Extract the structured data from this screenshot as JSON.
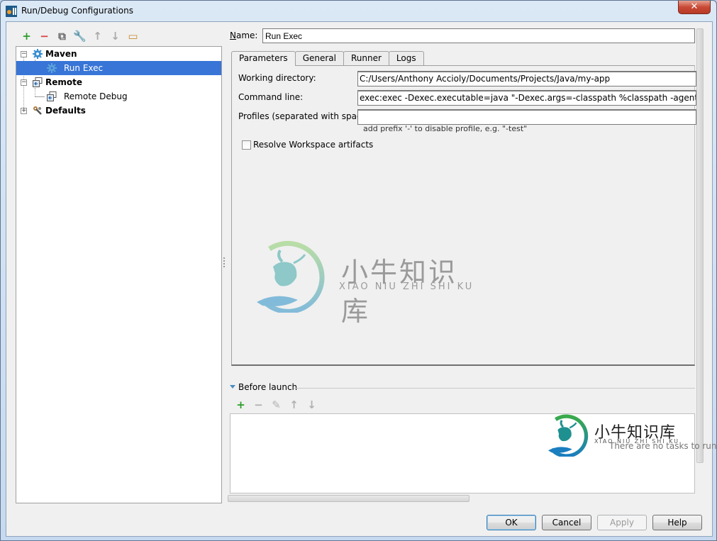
{
  "window": {
    "title": "Run/Debug Configurations",
    "close_glyph": "✕"
  },
  "toolbar": {
    "items": [
      {
        "name": "add",
        "glyph": "+",
        "color": "#2a9d2a"
      },
      {
        "name": "remove",
        "glyph": "−",
        "color": "#d94040"
      },
      {
        "name": "copy",
        "glyph": "⧉",
        "color": "#666666"
      },
      {
        "name": "edit-defaults",
        "glyph": "🔧",
        "color": "#b07b3a"
      },
      {
        "name": "move-up",
        "glyph": "↑",
        "color": "#aaaaaa"
      },
      {
        "name": "move-down",
        "glyph": "↓",
        "color": "#aaaaaa"
      },
      {
        "name": "folder",
        "glyph": "▭",
        "color": "#c88a2e"
      }
    ]
  },
  "tree": {
    "nodes": [
      {
        "label": "Maven",
        "bold": true,
        "expanded": true,
        "icon": "maven-gear-icon"
      },
      {
        "label": "Run Exec",
        "bold": false,
        "selected": true,
        "icon": "maven-gear-icon"
      },
      {
        "label": "Remote",
        "bold": true,
        "expanded": true,
        "icon": "remote-icon"
      },
      {
        "label": "Remote Debug",
        "bold": false,
        "icon": "remote-icon"
      },
      {
        "label": "Defaults",
        "bold": true,
        "expanded": false,
        "icon": "wrench-icon"
      }
    ],
    "collapse_glyph": "−",
    "expand_glyph": "+"
  },
  "config": {
    "name_label": "Name:",
    "name_value": "Run Exec",
    "tabs": [
      "Parameters",
      "General",
      "Runner",
      "Logs"
    ],
    "active_tab": "Parameters",
    "fields": {
      "working_dir_label": "Working directory:",
      "working_dir_value": "C:/Users/Anthony Accioly/Documents/Projects/Java/my-app",
      "command_line_label": "Command line:",
      "command_line_value": "exec:exec -Dexec.executable=java \"-Dexec.args=-classpath %classpath -agentlib:jdwp=tran",
      "profiles_label": "Profiles (separated with space):",
      "profiles_value": "",
      "profiles_hint": "add prefix '-' to disable profile, e.g. \"-test\"",
      "resolve_workspace_label": "Resolve Workspace artifacts",
      "resolve_workspace_checked": false
    }
  },
  "before_launch": {
    "label": "Before launch",
    "tools": [
      {
        "name": "add",
        "glyph": "+",
        "color": "#2a9d2a"
      },
      {
        "name": "remove",
        "glyph": "−",
        "color": "#b0b0b0"
      },
      {
        "name": "edit",
        "glyph": "✎",
        "color": "#b0b0b0"
      },
      {
        "name": "move-up",
        "glyph": "↑",
        "color": "#b0b0b0"
      },
      {
        "name": "move-down",
        "glyph": "↓",
        "color": "#b0b0b0"
      }
    ],
    "empty_text": "There are no tasks to run"
  },
  "watermark": {
    "cn": "小牛知识库",
    "en": "XIAO NIU ZHI SHI KU"
  },
  "buttons": {
    "ok": "OK",
    "cancel": "Cancel",
    "apply": "Apply",
    "help": "Help"
  },
  "colors": {
    "selection": "#3875d7",
    "accent_green": "#2a9d2a"
  }
}
